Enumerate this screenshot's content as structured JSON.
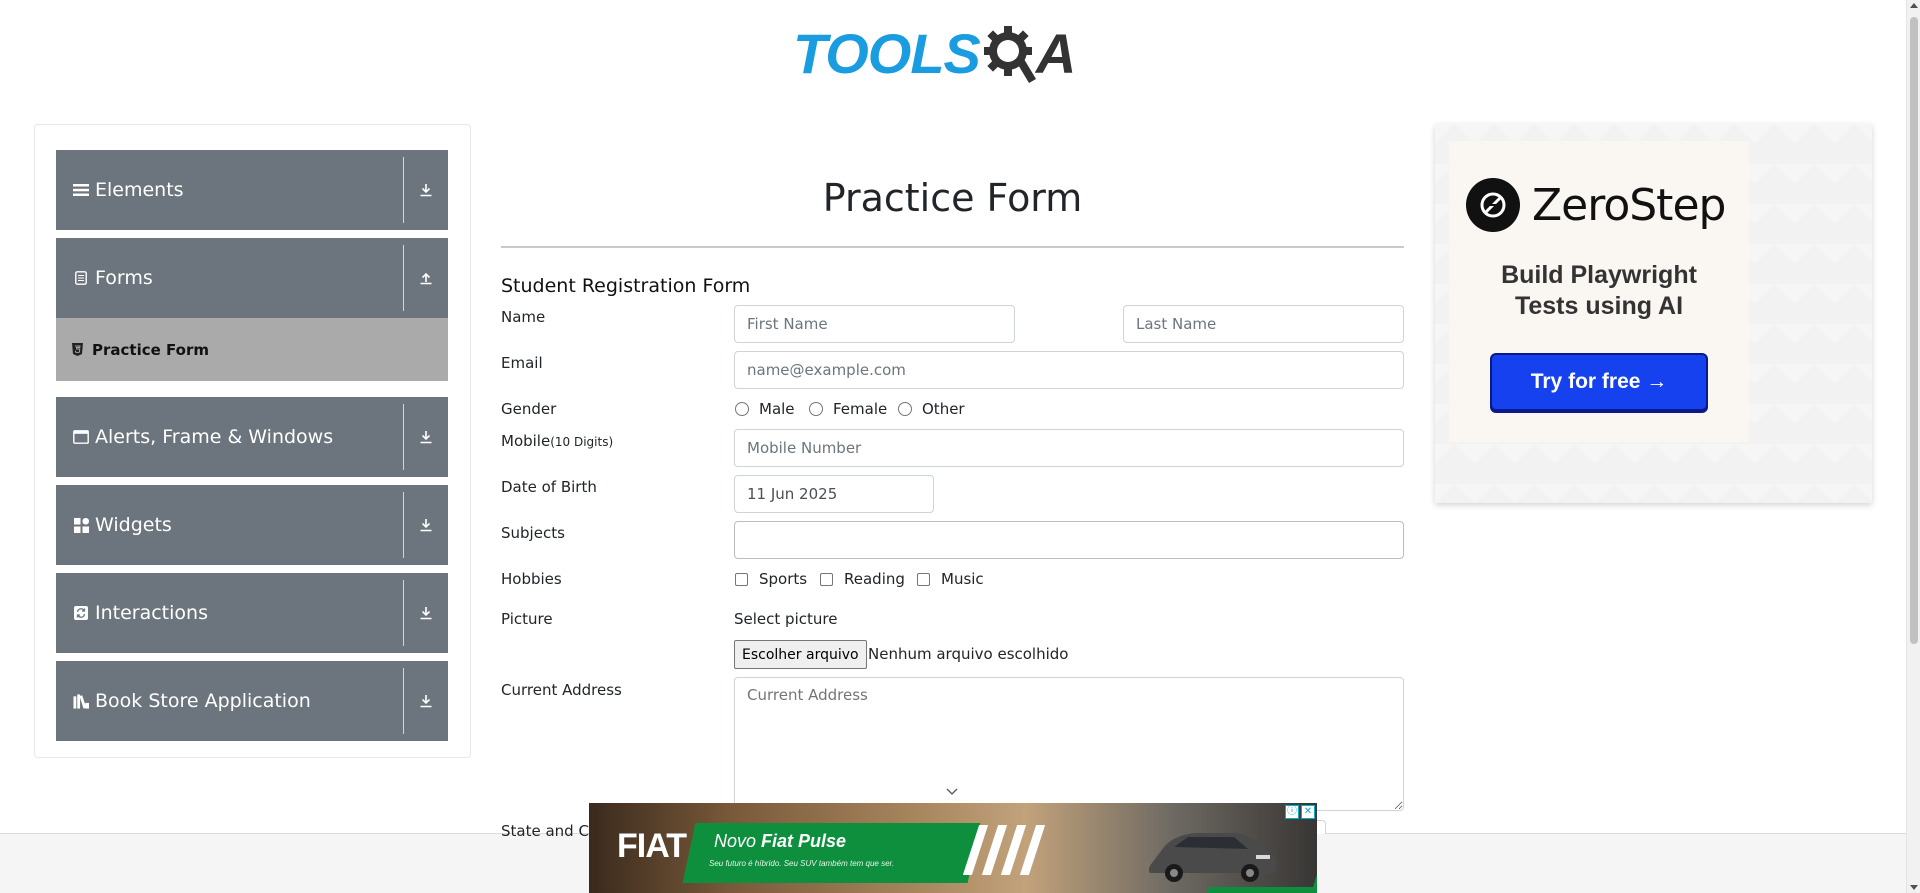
{
  "header": {
    "logo_text": "TOOLS",
    "logo_suffix": "A"
  },
  "sidebar": {
    "groups": [
      {
        "label": "Elements",
        "icon": "hamburger-icon",
        "arrow": "download-icon"
      },
      {
        "label": "Forms",
        "icon": "document-icon",
        "arrow": "upload-icon"
      },
      {
        "label": "Alerts, Frame & Windows",
        "icon": "window-icon",
        "arrow": "download-icon"
      },
      {
        "label": "Widgets",
        "icon": "grid-icon",
        "arrow": "download-icon"
      },
      {
        "label": "Interactions",
        "icon": "sync-icon",
        "arrow": "download-icon"
      },
      {
        "label": "Book Store Application",
        "icon": "books-icon",
        "arrow": "download-icon"
      }
    ],
    "active_sub": "Practice Form"
  },
  "main": {
    "title": "Practice Form",
    "subtitle": "Student Registration Form",
    "labels": {
      "name": "Name",
      "email": "Email",
      "gender": "Gender",
      "mobile": "Mobile",
      "mobile_hint": "(10 Digits)",
      "dob": "Date of Birth",
      "subjects": "Subjects",
      "hobbies": "Hobbies",
      "picture": "Picture",
      "address": "Current Address",
      "state": "State and Cit"
    },
    "placeholders": {
      "first_name": "First Name",
      "last_name": "Last Name",
      "email": "name@example.com",
      "mobile": "Mobile Number",
      "address": "Current Address"
    },
    "dob_value": "11 Jun 2025",
    "gender_options": [
      "Male",
      "Female",
      "Other"
    ],
    "hobby_options": [
      "Sports",
      "Reading",
      "Music"
    ],
    "picture_label": "Select picture",
    "file_button": "Escolher arquivo",
    "file_status": "Nenhum arquivo escolhido"
  },
  "ads": {
    "right": {
      "brand": "ZeroStep",
      "tagline_1": "Build Playwright",
      "tagline_2": "Tests using AI",
      "cta": "Try for free →"
    },
    "bottom": {
      "brand": "FIAT",
      "headline_1": "Novo ",
      "headline_2": "Fiat Pulse",
      "sub": "Seu futuro é híbrido. Seu SUV também tem que ser.",
      "info": "ⓘ",
      "close": "✕"
    }
  },
  "colors": {
    "sidebar_group": "#6c757d",
    "sidebar_active": "#aaaaaa",
    "logo_blue": "#1a9de0",
    "cta_blue": "#1541ee",
    "fiat_green": "#0d8f3e"
  }
}
